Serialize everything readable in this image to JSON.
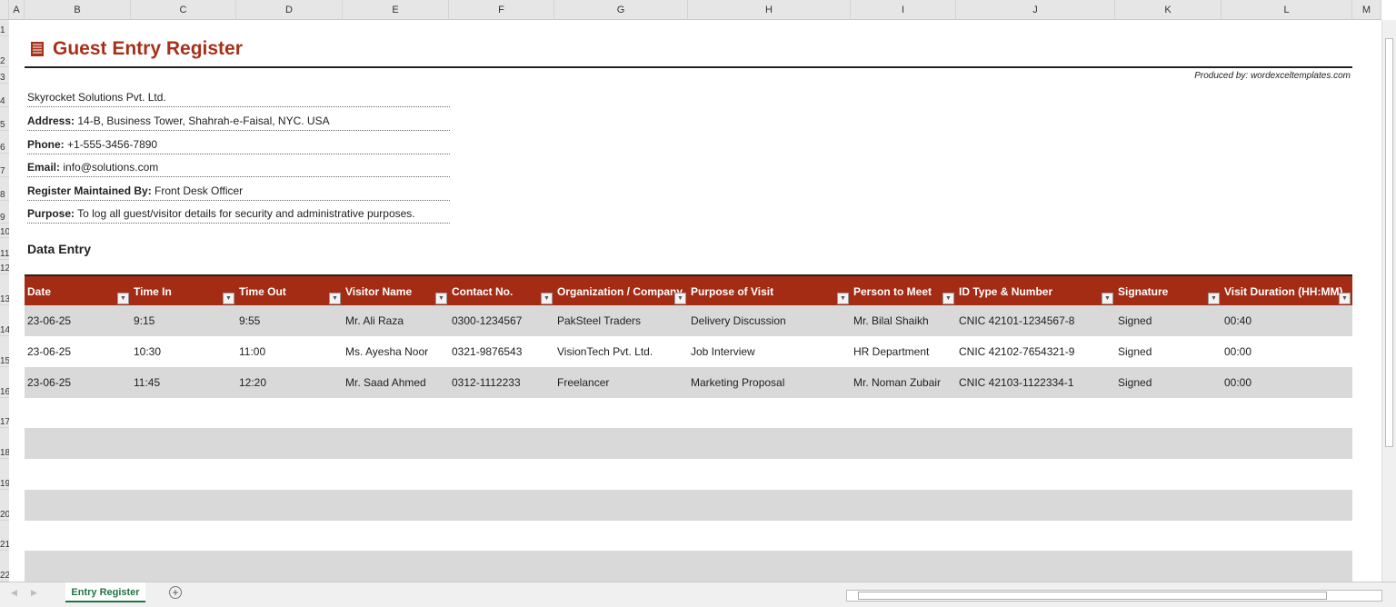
{
  "columns": [
    "A",
    "B",
    "C",
    "D",
    "E",
    "F",
    "G",
    "H",
    "I",
    "J",
    "K",
    "L",
    "M"
  ],
  "rows": [
    "1",
    "2",
    "3",
    "4",
    "5",
    "6",
    "7",
    "8",
    "9",
    "10",
    "11",
    "12",
    "13",
    "14",
    "15",
    "16",
    "17",
    "18",
    "19",
    "20",
    "21",
    "22"
  ],
  "title": "Guest Entry Register",
  "produced_by": "Produced by: wordexceltemplates.com",
  "company": "Skyrocket Solutions Pvt. Ltd.",
  "info": [
    {
      "label": "Address:",
      "value": " 14-B, Business Tower, Shahrah-e-Faisal, NYC. USA"
    },
    {
      "label": "Phone:",
      "value": " +1-555-3456-7890"
    },
    {
      "label": "Email:",
      "value": " info@solutions.com"
    },
    {
      "label": "Register Maintained By:",
      "value": " Front Desk Officer"
    },
    {
      "label": "Purpose:",
      "value": " To log all guest/visitor details for security and administrative purposes."
    }
  ],
  "section_title": "Data Entry",
  "table": {
    "headers": [
      "Date",
      "Time In",
      "Time Out",
      "Visitor Name",
      "Contact No.",
      "Organization / Company",
      "Purpose of Visit",
      "Person to Meet",
      "ID Type & Number",
      "Signature",
      "Visit Duration (HH:MM)"
    ],
    "rows": [
      [
        "23-06-25",
        "9:15",
        "9:55",
        "Mr. Ali Raza",
        "0300-1234567",
        "PakSteel Traders",
        "Delivery Discussion",
        "Mr. Bilal Shaikh",
        "CNIC 42101-1234567-8",
        "Signed",
        "00:40"
      ],
      [
        "23-06-25",
        "10:30",
        "11:00",
        "Ms. Ayesha Noor",
        "0321-9876543",
        "VisionTech Pvt. Ltd.",
        "Job Interview",
        "HR Department",
        "CNIC 42102-7654321-9",
        "Signed",
        "00:00"
      ],
      [
        "23-06-25",
        "11:45",
        "12:20",
        "Mr. Saad Ahmed",
        "0312-1112233",
        "Freelancer",
        "Marketing Proposal",
        "Mr. Noman Zubair",
        "CNIC 42103-1122334-1",
        "Signed",
        "00:00"
      ]
    ]
  },
  "sheet_tab": "Entry Register",
  "colors": {
    "accent": "#a52c14",
    "title": "#a8301a",
    "tab": "#217346",
    "shade": "#d9d9d9"
  }
}
